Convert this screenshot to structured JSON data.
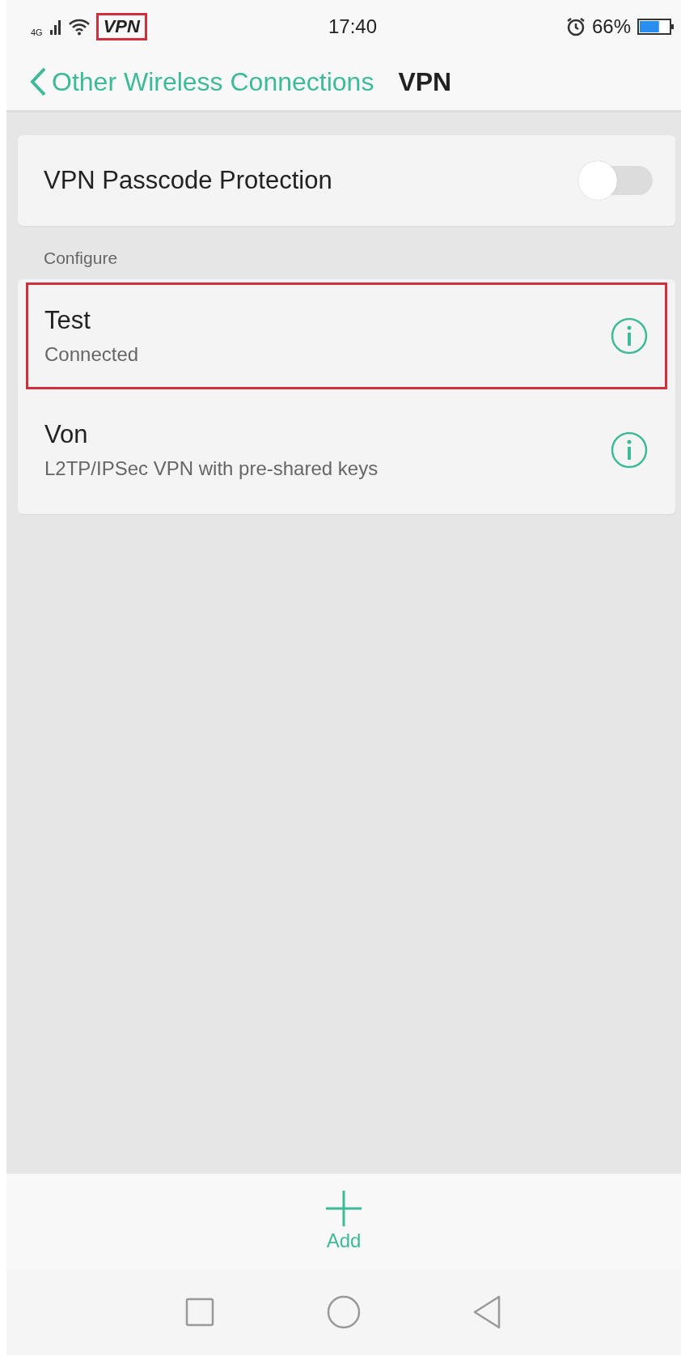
{
  "status_bar": {
    "network": "4G",
    "vpn": {
      "label": "VPN",
      "highlighted": true
    },
    "time": "17:40",
    "battery": {
      "label": "66%",
      "level": 0.66
    }
  },
  "header": {
    "back_label": "Other Wireless Connections",
    "title": "VPN"
  },
  "passcode": {
    "label": "VPN Passcode Protection",
    "on": false
  },
  "section_label": "Configure",
  "connections": [
    {
      "name": "Test",
      "subtitle": "Connected",
      "highlighted": true
    },
    {
      "name": "Von",
      "subtitle": "L2TP/IPSec VPN with pre-shared keys",
      "highlighted": false
    }
  ],
  "add_button": {
    "label": "Add"
  }
}
